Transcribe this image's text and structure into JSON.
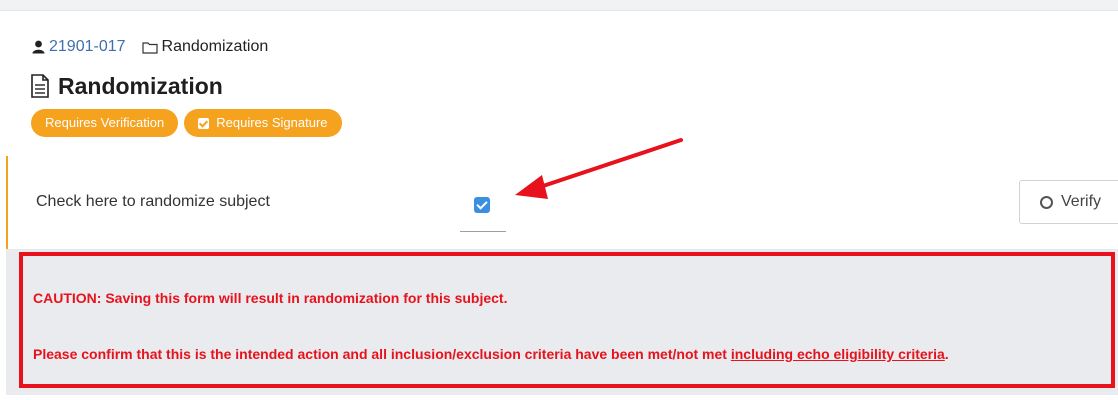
{
  "breadcrumb": {
    "subject_id": "21901-017",
    "folder": "Randomization"
  },
  "page_title": "Randomization",
  "badges": {
    "verification": "Requires Verification",
    "signature": "Requires Signature"
  },
  "question": {
    "label": "Check here to randomize subject",
    "checked": true
  },
  "verify_button": "Verify",
  "caution": {
    "line1": "CAUTION: Saving this form will result in randomization for this subject.",
    "line2_prefix": "Please confirm that this is the intended action and all inclusion/exclusion criteria have been met/not met ",
    "line2_link": "including echo eligibility criteria",
    "line2_suffix": "."
  },
  "colors": {
    "accent": "#f5a21f",
    "link": "#3f6fb0",
    "caution": "#e8121c",
    "checkbox": "#3b8fe0"
  },
  "icons": {
    "subject": "user-icon",
    "folder": "folder-icon",
    "title": "document-icon",
    "verify": "circle-icon"
  }
}
